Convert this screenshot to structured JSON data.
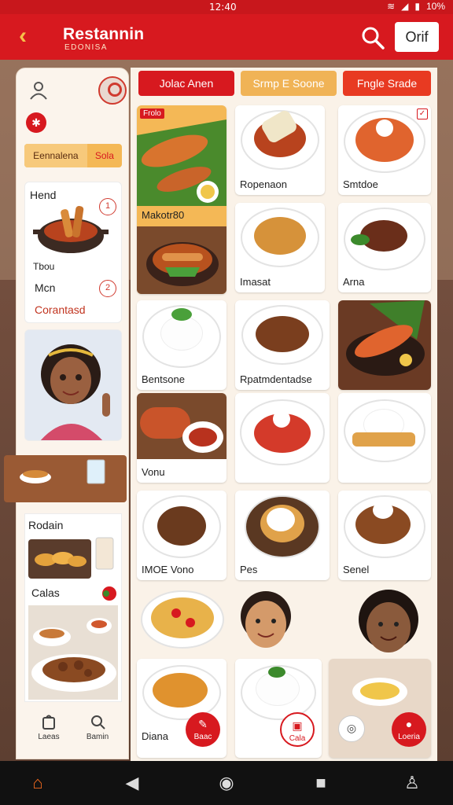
{
  "status_bar": {
    "time": "12:40",
    "battery": "10%"
  },
  "header": {
    "title": "Restannin",
    "subtitle": "EDONISA",
    "top_button": "Orif"
  },
  "sidebar": {
    "tabs": [
      {
        "label": "Eennalena"
      },
      {
        "label": "Sola"
      }
    ],
    "menu_items": [
      {
        "label": "Hend",
        "num": "1"
      },
      {
        "label": "Tbou",
        "num": ""
      },
      {
        "label": "Mcn",
        "num": "2"
      }
    ],
    "combo_label": "Corantasd",
    "bottom_section_title": "Rodain",
    "bottom_item": "Calas",
    "bottom_nav": [
      {
        "label": "Laeas"
      },
      {
        "label": "Bamin"
      }
    ]
  },
  "main": {
    "category_buttons": [
      {
        "label": "Jolac Anen"
      },
      {
        "label": "Srmp E Soone"
      },
      {
        "label": "Fngle Srade"
      }
    ],
    "grid": [
      {
        "name": "Makotr80",
        "badge": "Frolo"
      },
      {
        "name": "Ropenaon"
      },
      {
        "name": "Smtdoe"
      },
      {
        "name": "Imasat"
      },
      {
        "name": "Arna"
      },
      {
        "name": "Bentsone"
      },
      {
        "name": "Rpatmdentadse"
      },
      {
        "name": "Vonu"
      },
      {
        "name": "IMOE Vono"
      },
      {
        "name": "Pes"
      },
      {
        "name": "Senel"
      },
      {
        "name": "Diana"
      }
    ],
    "fabs": [
      {
        "label": "Baac"
      },
      {
        "label": "Cala"
      },
      {
        "label": ""
      },
      {
        "label": "Loeria"
      }
    ]
  },
  "colors": {
    "brand_red": "#d7191f",
    "accent_orange": "#f4b856",
    "background_cream": "#faf2e8"
  },
  "icons": [
    "back-icon",
    "search-icon",
    "person-icon",
    "home-icon",
    "back-triangle-icon",
    "home-circle-icon",
    "square-icon",
    "profile-icon"
  ]
}
